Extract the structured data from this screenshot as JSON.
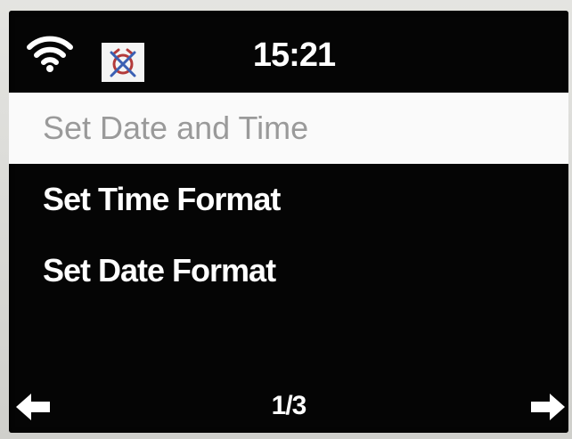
{
  "status_bar": {
    "time": "15:21",
    "icons": [
      "wifi-icon",
      "alarm-icon"
    ]
  },
  "menu": {
    "items": [
      {
        "label": "Set Date and Time",
        "selected": true
      },
      {
        "label": "Set Time Format",
        "selected": false
      },
      {
        "label": "Set Date Format",
        "selected": false
      }
    ]
  },
  "navigation": {
    "page": "1/3",
    "left_icon": "arrow-left-icon",
    "right_icon": "arrow-right-icon"
  },
  "colors": {
    "screen_background": "#050505",
    "text": "#ffffff",
    "selected_background": "#fafafa",
    "selected_text": "#9a9a9a"
  }
}
